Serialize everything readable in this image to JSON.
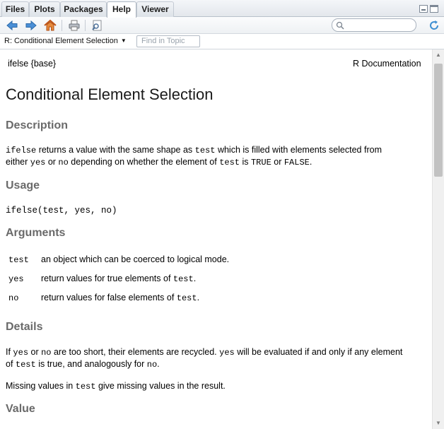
{
  "tabs": [
    "Files",
    "Plots",
    "Packages",
    "Help",
    "Viewer"
  ],
  "active_tab": "Help",
  "icons": {
    "back": "back-arrow-icon",
    "forward": "forward-arrow-icon",
    "home": "home-icon",
    "print": "print-icon",
    "find": "find-in-page-icon",
    "search": "search-icon",
    "refresh": "refresh-icon"
  },
  "colors": {
    "accent": "#3a78c3",
    "heading": "#6a6a6a",
    "home": "#d36b1c"
  },
  "topic_selector": "R: Conditional Element Selection",
  "find_placeholder": "Find in Topic",
  "doc": {
    "header_left": "ifelse {base}",
    "header_right": "R Documentation",
    "title": "Conditional Element Selection",
    "description_heading": "Description",
    "description_line1": {
      "c1": "ifelse",
      "t1": " returns a value with the same shape as ",
      "c2": "test",
      "t2": " which is filled with elements selected from"
    },
    "description_line2": {
      "t1": "either ",
      "c1": "yes",
      "t2": " or ",
      "c2": "no",
      "t3": " depending on whether the element of ",
      "c3": "test",
      "t4": " is ",
      "c4": "TRUE",
      "t5": " or ",
      "c5": "FALSE",
      "t6": "."
    },
    "usage_heading": "Usage",
    "usage_code": "ifelse(test, yes, no)",
    "arguments_heading": "Arguments",
    "arguments": [
      {
        "name": "test",
        "desc": "an object which can be coerced to logical mode."
      },
      {
        "name": "yes",
        "desc_pre": "return values for true elements of ",
        "desc_code": "test",
        "desc_post": "."
      },
      {
        "name": "no",
        "desc_pre": "return values for false elements of ",
        "desc_code": "test",
        "desc_post": "."
      }
    ],
    "details_heading": "Details",
    "details_line1": {
      "t1": "If ",
      "c1": "yes",
      "t2": " or ",
      "c2": "no",
      "t3": " are too short, their elements are recycled. ",
      "c3": "yes",
      "t4": " will be evaluated if and only if any element"
    },
    "details_line2": {
      "t1": "of ",
      "c1": "test",
      "t2": " is true, and analogously for ",
      "c2": "no",
      "t3": "."
    },
    "details_p2": {
      "t1": "Missing values in ",
      "c1": "test",
      "t2": " give missing values in the result."
    },
    "value_heading": "Value"
  }
}
